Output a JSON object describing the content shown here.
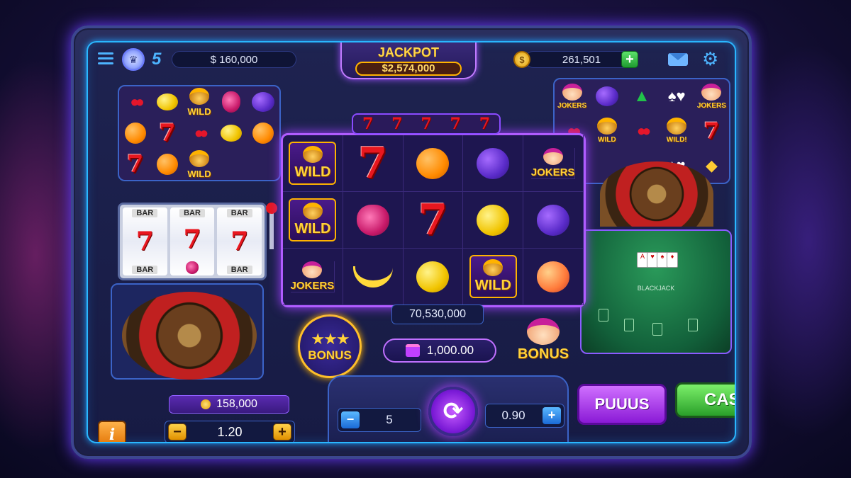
{
  "topbar": {
    "balance": "$ 160,000",
    "jackpot_label": "JACKPOT",
    "jackpot_value": "$2,574,000",
    "coins": "261,501",
    "add_coins": "+",
    "level": "5"
  },
  "left_slot": {
    "rows": [
      [
        "cherry",
        "lemon",
        "wild",
        "berry",
        "plum"
      ],
      [
        "orange",
        "seven",
        "cherry",
        "lemon",
        "orange"
      ],
      [
        "seven",
        "orange",
        "wild",
        "",
        ""
      ]
    ],
    "wild_text": "WILD"
  },
  "classic_slot": {
    "bar_label": "BAR",
    "seven": "7"
  },
  "center_slot": {
    "strip": [
      "7",
      "7",
      "7",
      "7",
      "7"
    ],
    "rows": [
      [
        "wild",
        "seven",
        "orange",
        "plum",
        "jokers"
      ],
      [
        "wild",
        "berry",
        "seven",
        "lemon",
        "plum"
      ],
      [
        "jokers",
        "banana",
        "lemon",
        "wild",
        "peach"
      ]
    ],
    "wild_text": "WILD",
    "jokers_text": "JOKERS",
    "seven": "7",
    "total": "70,530,000"
  },
  "right_slot": {
    "rows": [
      [
        "jokers",
        "plum",
        "tree",
        "cards",
        "jokers"
      ],
      [
        "cherry",
        "wild",
        "cherry",
        "wild",
        "seven"
      ],
      [
        "cherry",
        "",
        "",
        "cards",
        "diamond"
      ]
    ],
    "wild_text": "WILD",
    "wild_alt_text": "WILD!",
    "jokers_text": "JOKERS",
    "seven": "7"
  },
  "bonus": {
    "stars_label": "BONUS",
    "jester_label": "BONUS",
    "gift_value": "1,000.00"
  },
  "blackjack": {
    "title": "BLACKJACK"
  },
  "controls": {
    "info": "i",
    "bottom_total": "158,000",
    "bet_minus": "−",
    "bet_plus": "+",
    "bet_value": "1.20",
    "lines_minus": "−",
    "lines_value": "5",
    "coin_value": "0.90",
    "coin_plus": "+",
    "plus_label": "PUUUS",
    "cash_label": "CASH"
  },
  "colors": {
    "neon_blue": "#2ab7ff",
    "neon_purple": "#b05cff",
    "gold": "#ffd23a",
    "cash_green": "#2aa02a"
  }
}
